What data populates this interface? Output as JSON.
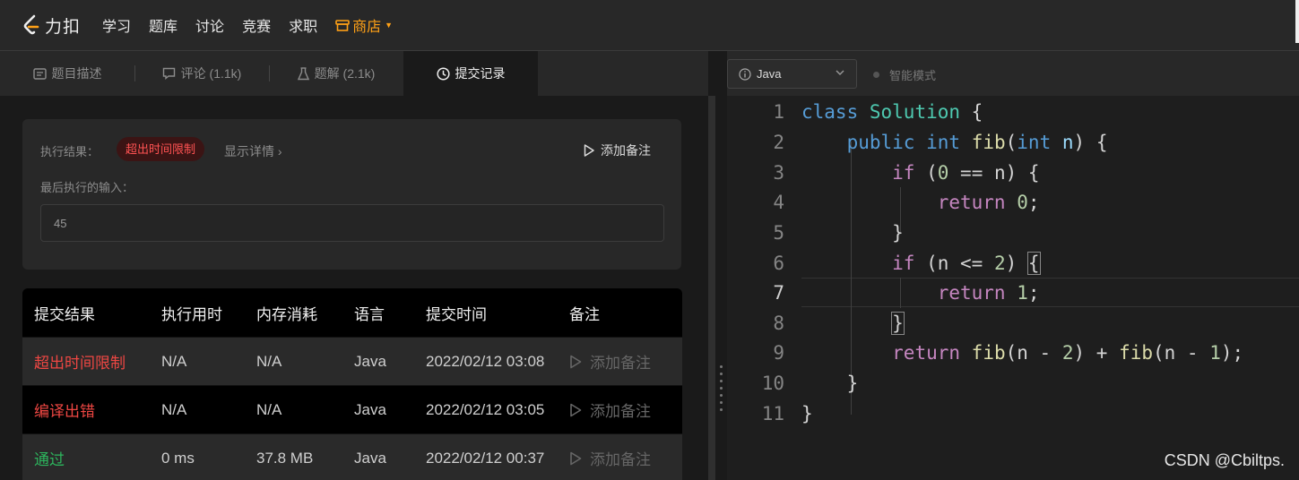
{
  "nav": {
    "logo_text": "力扣",
    "items": [
      "学习",
      "题库",
      "讨论",
      "竞赛",
      "求职"
    ],
    "shop": "商店",
    "accent": "#ffa116"
  },
  "tabs": [
    {
      "label": "题目描述",
      "icon": "document-icon"
    },
    {
      "label": "评论 (1.1k)",
      "icon": "comment-icon"
    },
    {
      "label": "题解 (2.1k)",
      "icon": "flask-icon"
    },
    {
      "label": "提交记录",
      "icon": "clock-icon",
      "active": true
    }
  ],
  "result": {
    "label": "执行结果：",
    "status": "超出时间限制",
    "details": "显示详情 ›",
    "add_note": "添加备注",
    "last_input_label": "最后执行的输入：",
    "last_input": "45"
  },
  "submissions": {
    "headers": [
      "提交结果",
      "执行用时",
      "内存消耗",
      "语言",
      "提交时间",
      "备注"
    ],
    "rows": [
      {
        "status": "超出时间限制",
        "status_color": "#ef4743",
        "time": "N/A",
        "memory": "N/A",
        "lang": "Java",
        "submitted": "2022/02/12 03:08",
        "note": "添加备注"
      },
      {
        "status": "编译出错",
        "status_color": "#ef4743",
        "time": "N/A",
        "memory": "N/A",
        "lang": "Java",
        "submitted": "2022/02/12 03:05",
        "note": "添加备注"
      },
      {
        "status": "通过",
        "status_color": "#2db55d",
        "time": "0 ms",
        "memory": "37.8 MB",
        "lang": "Java",
        "submitted": "2022/02/12 00:37",
        "note": "添加备注"
      }
    ]
  },
  "editor": {
    "language": "Java",
    "smart_mode": "智能模式",
    "line_numbers": [
      "1",
      "2",
      "3",
      "4",
      "5",
      "6",
      "7",
      "8",
      "9",
      "10",
      "11"
    ],
    "current_line": 7,
    "code_lines": [
      "class Solution {",
      "    public int fib(int n) {",
      "        if (0 == n) {",
      "            return 0;",
      "        }",
      "        if (n <= 2) {",
      "            return 1;",
      "        }",
      "        return fib(n - 2) + fib(n - 1);",
      "    }",
      "}"
    ]
  },
  "watermark": "CSDN @Cbiltps."
}
